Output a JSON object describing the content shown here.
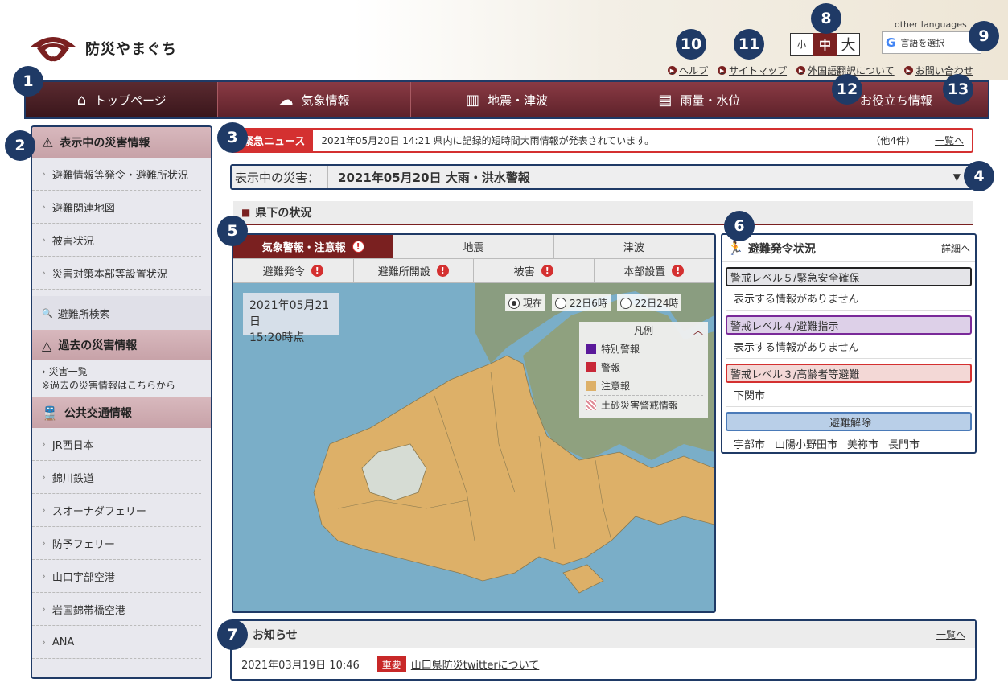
{
  "header": {
    "site_title": "防災やまぐち",
    "other_languages": "other languages",
    "translate_label": "言語を選択",
    "font_size": {
      "small": "小",
      "medium": "中",
      "large": "大"
    },
    "utility_links": [
      "ヘルプ",
      "サイトマップ",
      "外国語翻訳について",
      "お問い合わせ"
    ]
  },
  "nav": {
    "items": [
      {
        "label": "トップページ",
        "icon": "home-icon"
      },
      {
        "label": "気象情報",
        "icon": "weather-icon"
      },
      {
        "label": "地震・津波",
        "icon": "building-icon"
      },
      {
        "label": "雨量・水位",
        "icon": "gauge-icon"
      },
      {
        "label": "お役立ち情報",
        "icon": "info-icon"
      }
    ]
  },
  "sidebar": {
    "current_title": "表示中の災害情報",
    "current_items": [
      "避難情報等発令・避難所状況",
      "避難関連地図",
      "被害状況",
      "災害対策本部等設置状況"
    ],
    "search_label": "避難所検索",
    "past_title": "過去の災害情報",
    "past_link": "災害一覧",
    "past_note": "※過去の災害情報はこちらから",
    "transport_title": "公共交通情報",
    "transport_items": [
      "JR西日本",
      "錦川鉄道",
      "スオーナダフェリー",
      "防予フェリー",
      "山口宇部空港",
      "岩国錦帯橋空港",
      "ANA"
    ]
  },
  "news": {
    "label": "緊急ニュース",
    "text": "2021年05月20日 14:21 県内に記録的短時間大雨情報が発表されています。",
    "count": "（他4件）",
    "list_link": "一覧へ"
  },
  "disaster": {
    "label": "表示中の災害：",
    "value": "2021年05月20日 大雨・洪水警報"
  },
  "section": {
    "title": "県下の状況"
  },
  "map": {
    "tabs_row1": [
      "気象警報・注意報",
      "地震",
      "津波"
    ],
    "tabs_row2": [
      "避難発令",
      "避難所開設",
      "被害",
      "本部設置"
    ],
    "date": "2021年05月21日",
    "time": "15:20時点",
    "radios": [
      "現在",
      "22日6時",
      "22日24時"
    ],
    "legend_title": "凡例",
    "legend_items": [
      {
        "label": "特別警報",
        "color": "#5a1a9a"
      },
      {
        "label": "警報",
        "color": "#c82838"
      },
      {
        "label": "注意報",
        "color": "#ddb068"
      },
      {
        "label": "土砂災害警戒情報",
        "color": "#e08a96"
      }
    ]
  },
  "evacuation": {
    "title": "避難発令状況",
    "detail_link": "詳細へ",
    "level5": "警戒レベル５/緊急安全確保",
    "level5_body": "表示する情報がありません",
    "level4": "警戒レベル４/避難指示",
    "level4_body": "表示する情報がありません",
    "level3": "警戒レベル３/高齢者等避難",
    "level3_body": "下関市",
    "release": "避難解除",
    "release_cities": [
      "宇部市",
      "山陽小野田市",
      "美祢市",
      "長門市"
    ]
  },
  "notice": {
    "title": "お知らせ",
    "list_link": "一覧へ",
    "date": "2021年03月19日 10:46",
    "badge": "重要",
    "link": "山口県防災twitterについて"
  },
  "markers": [
    "1",
    "2",
    "3",
    "4",
    "5",
    "6",
    "7",
    "8",
    "9",
    "10",
    "11",
    "12",
    "13"
  ]
}
